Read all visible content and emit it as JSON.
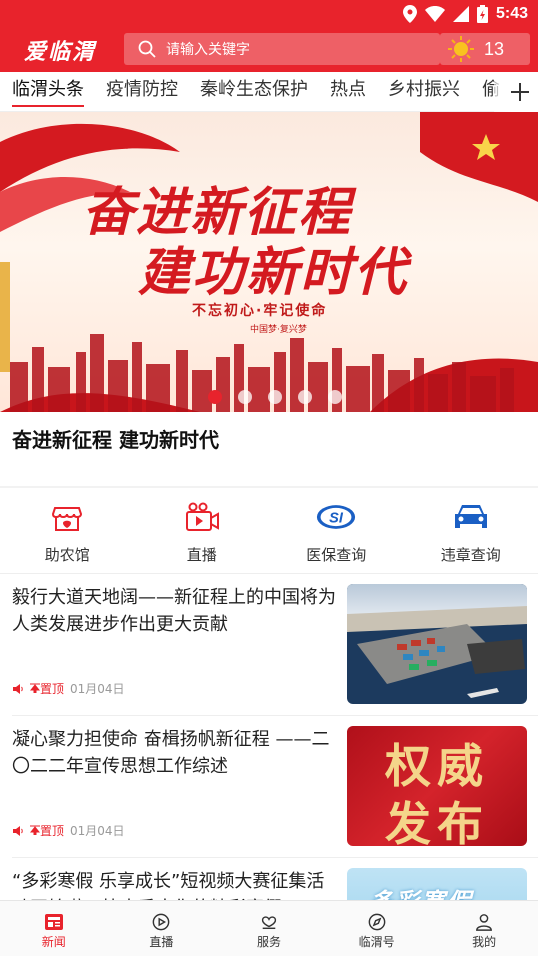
{
  "status_bar": {
    "time": "5:43",
    "icons": [
      "location-icon",
      "wifi-icon",
      "signal-icon",
      "battery-icon"
    ]
  },
  "header": {
    "logo": "爱临渭",
    "search_placeholder": "请输入关键字",
    "weather": {
      "icon": "sun-icon",
      "temperature": "13"
    }
  },
  "tabs": [
    {
      "label": "临渭头条",
      "active": true
    },
    {
      "label": "疫情防控"
    },
    {
      "label": "秦岭生态保护"
    },
    {
      "label": "热点"
    },
    {
      "label": "乡村振兴"
    },
    {
      "label": "偷"
    }
  ],
  "banner": {
    "line1": "奋进新征程",
    "line2": "建功新时代",
    "sub1": "不忘初心·牢记使命",
    "sub2": "中国梦·复兴梦",
    "caption": "奋进新征程  建功新时代",
    "dots": 5,
    "active_dot": 1
  },
  "services": [
    {
      "label": "助农馆",
      "icon": "shop-icon"
    },
    {
      "label": "直播",
      "icon": "live-camera-icon"
    },
    {
      "label": "医保查询",
      "icon": "medical-insurance-icon"
    },
    {
      "label": "违章查询",
      "icon": "car-icon"
    }
  ],
  "news": [
    {
      "title": "毅行大道天地阔——新征程上的中国将为人类发展进步作出更大贡献",
      "tag": "置顶",
      "date": "01月04日",
      "thumb": "port-photo"
    },
    {
      "title": "凝心聚力担使命 奋楫扬帆新征程 ——二〇二二年宣传思想工作综述",
      "tag": "置顶",
      "date": "01月04日",
      "thumb": "authority-release",
      "thumb_text": [
        "权威",
        "发布"
      ]
    },
    {
      "title": "“多彩寒假 乐享成长”短视频大赛征集活动开始啦，快来秀出你的精彩寒假",
      "tag": "",
      "date": "",
      "thumb": "winter-holiday",
      "thumb_text": "多彩寒假"
    }
  ],
  "bottom_nav": [
    {
      "label": "新闻",
      "icon": "news-icon",
      "active": true
    },
    {
      "label": "直播",
      "icon": "play-icon"
    },
    {
      "label": "服务",
      "icon": "service-heart-icon"
    },
    {
      "label": "临渭号",
      "icon": "compass-icon"
    },
    {
      "label": "我的",
      "icon": "user-icon"
    }
  ],
  "colors": {
    "brand_red": "#e8232c"
  }
}
